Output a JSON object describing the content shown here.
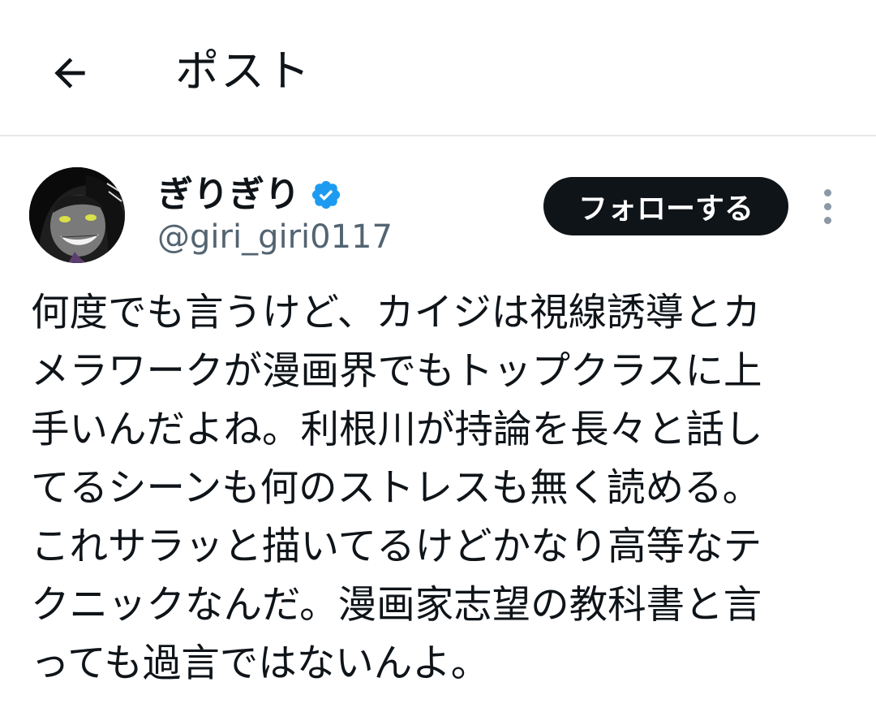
{
  "header": {
    "title": "ポスト",
    "back_icon": "arrow-left-icon"
  },
  "author": {
    "display_name": "ぎりぎり",
    "handle": "@giri_giri0117",
    "verified_icon": "verified-badge-icon",
    "verified_color": "#1d9bf0"
  },
  "actions": {
    "follow_label": "フォローする",
    "more_icon": "more-vertical-icon"
  },
  "post": {
    "text": "何度でも言うけど、カイジは視線誘導とカ\nメラワークが漫画界でもトップクラスに上\n手いんだよね。利根川が持論を長々と話し\nてるシーンも何のストレスも無く読める。\nこれサラッと描いてるけどかなり高等なテ\nクニックなんだ。漫画家志望の教科書と言\nっても過言ではないんよ。"
  },
  "colors": {
    "text": "#0f1419",
    "secondary": "#536471",
    "follow_bg": "#0f1419",
    "divider": "#e6e8ea"
  }
}
